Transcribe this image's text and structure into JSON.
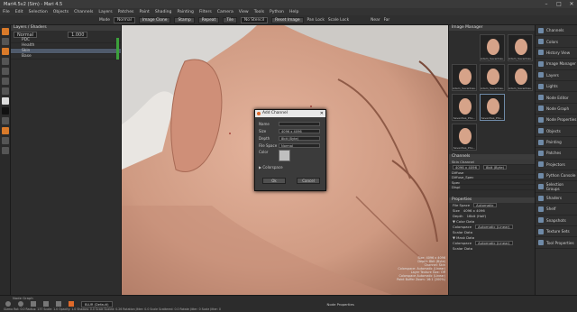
{
  "window": {
    "title": "Mari4.5v2 (Sim) - Mari 4.5",
    "controls": [
      "–",
      "□",
      "✕"
    ]
  },
  "menu": [
    "File",
    "Edit",
    "Selection",
    "Objects",
    "Channels",
    "Layers",
    "Patches",
    "Paint",
    "Shading",
    "Painting",
    "Filters",
    "Camera",
    "View",
    "Tools",
    "Python",
    "Help"
  ],
  "toolbar": {
    "mode_label": "Mode",
    "mode_value": "Normal",
    "image_clone": "Image Clone",
    "stamp": "Stamp",
    "repeat": "Repeat",
    "tile": "Tile",
    "no_stencil": "No Stencil",
    "reset_image": "Reset Image",
    "pan_lock": "Pan Lock",
    "scale_lock": "Scale Lock",
    "near": "Near",
    "far": "Far"
  },
  "layers_panel": {
    "title": "Layers / Shaders",
    "blend": "Normal",
    "opacity": "1.000",
    "layers": [
      {
        "name": "PDC"
      },
      {
        "name": "Health"
      },
      {
        "name": "Skin"
      },
      {
        "name": "Base"
      }
    ]
  },
  "viewport": {
    "tabs": [
      "Ortho",
      "UV",
      "Perspective",
      "Shaders",
      "Ortho"
    ]
  },
  "dialog": {
    "title": "Add Channel",
    "close": "✕",
    "name_label": "Name",
    "name_value": "",
    "size_label": "Size",
    "size_value": "4096 x 4096",
    "depth_label": "Depth",
    "depth_value": "8bit (Byte)",
    "filespace_label": "File Space",
    "filespace_value": "Normal",
    "color_label": "Color",
    "colorspace_label": "▶ Colorspace",
    "ok": "Ok",
    "cancel": "Cancel"
  },
  "overlay": [
    "Size: 4096 x 4096",
    "Depth: 8bit (Byte)",
    "Channel: Skin",
    "Colorspace: Automatic (Linear)",
    "Layer Texture Size: Off",
    "Colorspace Automatic (Linear)",
    "Paint Buffer Zoom: 16:1 (200%)"
  ],
  "image_manager": {
    "title": "Image Manager",
    "thumbs": [
      {
        "caption": ""
      },
      {
        "caption": "Adam_Seventies..."
      },
      {
        "caption": "Adam_Seventies..."
      },
      {
        "caption": "Adam_Seventies..."
      },
      {
        "caption": "Adam_Seventies..."
      },
      {
        "caption": "Adam_Seventies..."
      },
      {
        "caption": "Seventies_Pho..."
      },
      {
        "caption": "Seventies_Pho..."
      },
      {
        "caption": ""
      },
      {
        "caption": "Seventies_Pho..."
      }
    ]
  },
  "channels_panel": {
    "title": "Channels",
    "channel_label": "Skin Channel",
    "size": "4096 x 4096",
    "depth": "8bit (Byte)",
    "channels": [
      "Diffuse",
      "Diffuse_Spec",
      "Spec",
      "Displ"
    ]
  },
  "properties": {
    "title": "Properties",
    "rows": [
      {
        "label": "File Space",
        "value": "Automatic"
      },
      {
        "label": "Size",
        "value": "4096 x 4096"
      },
      {
        "label": "Depth",
        "value": "16bit (Half)"
      },
      {
        "label": "▼ Color Data",
        "value": ""
      },
      {
        "label": "Colorspace",
        "value": "Automatic (Linear)"
      },
      {
        "label": "Scalar Data",
        "value": ""
      },
      {
        "label": "▼ Mask Data",
        "value": ""
      },
      {
        "label": "Colorspace",
        "value": "Automatic (Linear)"
      },
      {
        "label": "Scalar Data",
        "value": ""
      }
    ]
  },
  "right_nav": [
    "Channels",
    "Colors",
    "History View",
    "Image Manager",
    "Layers",
    "Lights",
    "Node Editor",
    "Node Graph",
    "Node Properties",
    "Objects",
    "Painting",
    "Patches",
    "Projectors",
    "Python Console",
    "Selection Groups",
    "Shaders",
    "Shelf",
    "Snapshots",
    "Texture Sets",
    "Tool Properties"
  ],
  "bottom": {
    "node_graph": "Node Graph",
    "status": "Gizmo Rot: 0.0   Radius: 137   Scale: 1.0   Opacity: 1.0   Shadow: 0.0   Scale Scaled: 0.26   Rotation Jitter: 0.0   Scale Scattered: 0.0   Rotate Jitter: 0   Scale Jitter: 0",
    "painting_label": "BLUR (Default)",
    "node_properties": "Node Properties"
  },
  "colors": {
    "accent": "#e06a2a",
    "selected": "#4f5a6b",
    "green": "#3ca13c"
  }
}
